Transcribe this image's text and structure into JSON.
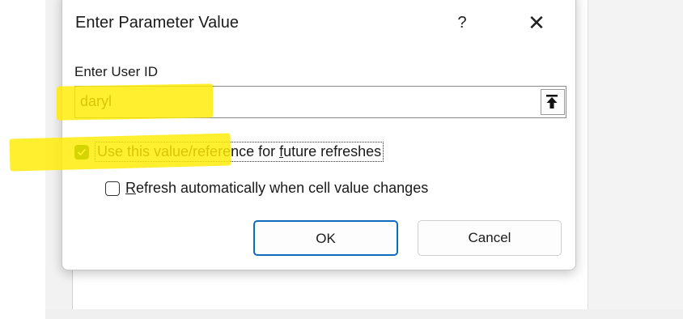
{
  "dialog": {
    "title": "Enter Parameter Value",
    "help_glyph": "?",
    "close_glyph": "✕",
    "prompt": "Enter User ID",
    "input_value": "daryl"
  },
  "options": {
    "use_value": {
      "pre": "Use this value/reference for ",
      "accel": "f",
      "post": "uture refreshes",
      "checked": true
    },
    "refresh_auto": {
      "accel": "R",
      "post": "efresh automatically when cell value changes",
      "checked": false
    }
  },
  "buttons": {
    "ok": "OK",
    "cancel": "Cancel"
  },
  "colors": {
    "accent": "#0f6cbd",
    "checkbox_checked": "#1a6b1a",
    "highlighter": "#ffeb00"
  },
  "icons": {
    "ref_button": "collapse-upload-icon",
    "close": "close-icon"
  }
}
